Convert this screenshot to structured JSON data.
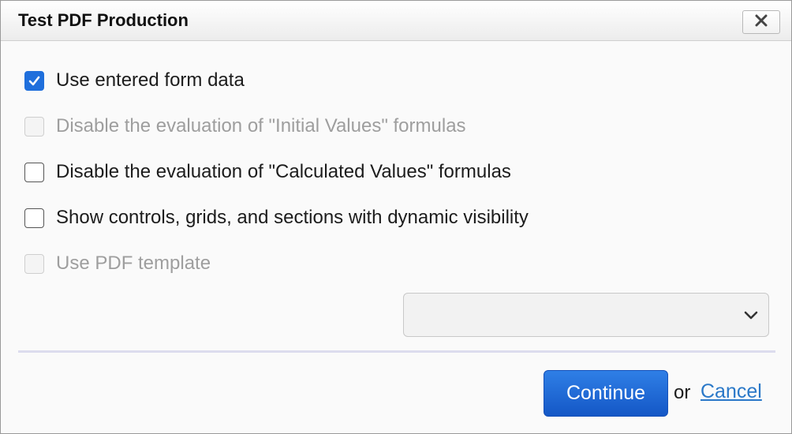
{
  "dialog": {
    "title": "Test PDF Production",
    "close_icon": "close-icon"
  },
  "options": [
    {
      "label": "Use entered form data",
      "checked": true,
      "disabled": false
    },
    {
      "label": "Disable the evaluation of \"Initial Values\" formulas",
      "checked": false,
      "disabled": true
    },
    {
      "label": "Disable the evaluation of \"Calculated Values\" formulas",
      "checked": false,
      "disabled": false
    },
    {
      "label": "Show controls, grids, and sections with dynamic visibility",
      "checked": false,
      "disabled": false
    },
    {
      "label": "Use PDF template",
      "checked": false,
      "disabled": true
    }
  ],
  "template_select": {
    "value": "",
    "icon": "chevron-down-icon"
  },
  "footer": {
    "continue_label": "Continue",
    "or_text": "or",
    "cancel_label": "Cancel"
  },
  "colors": {
    "accent": "#1f6fdc",
    "link": "#2a78c8",
    "disabled_text": "#9e9e9e"
  }
}
